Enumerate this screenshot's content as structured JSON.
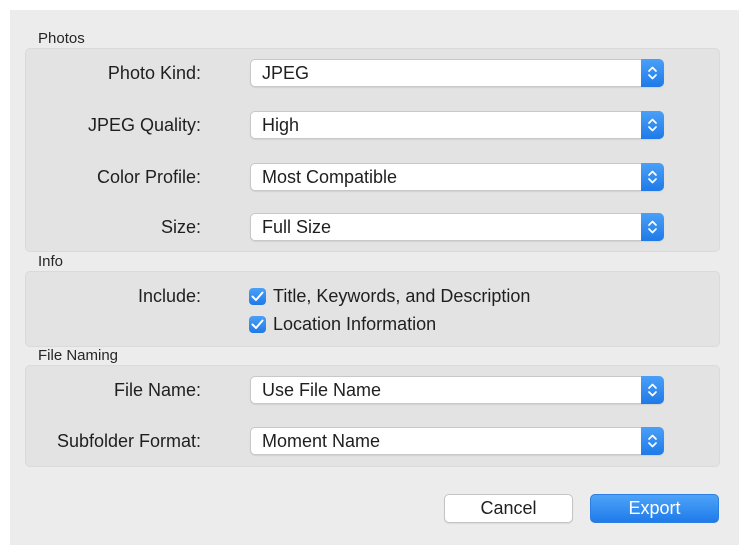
{
  "sections": {
    "photos": {
      "title": "Photos",
      "photo_kind": {
        "label": "Photo Kind:",
        "value": "JPEG"
      },
      "jpeg_quality": {
        "label": "JPEG Quality:",
        "value": "High"
      },
      "color_profile": {
        "label": "Color Profile:",
        "value": "Most Compatible"
      },
      "size": {
        "label": "Size:",
        "value": "Full Size"
      }
    },
    "info": {
      "title": "Info",
      "include_label": "Include:",
      "options": [
        {
          "label": "Title, Keywords, and Description",
          "checked": true
        },
        {
          "label": "Location Information",
          "checked": true
        }
      ]
    },
    "file_naming": {
      "title": "File Naming",
      "file_name": {
        "label": "File Name:",
        "value": "Use File Name"
      },
      "subfolder_format": {
        "label": "Subfolder Format:",
        "value": "Moment Name"
      }
    }
  },
  "buttons": {
    "cancel": "Cancel",
    "export": "Export"
  },
  "icons": {
    "collapse": "chevron-up-icon",
    "popup": "up-down-chevron-icon",
    "check": "checkmark-icon"
  },
  "colors": {
    "accent": "#1f7ae8"
  }
}
